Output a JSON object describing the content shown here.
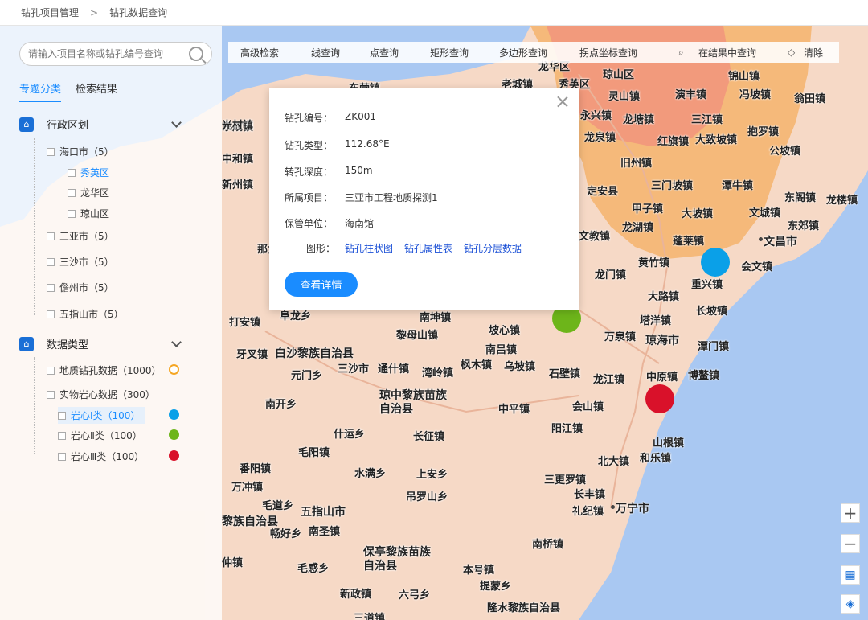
{
  "breadcrumb": [
    "钻孔项目管理",
    "钻孔数据查询"
  ],
  "breadcrumb_sep": ">",
  "search": {
    "placeholder": "请输入项目名称或钻孔编号查询"
  },
  "left_tabs": [
    "专题分类",
    "检索结果"
  ],
  "admin": {
    "title": "行政区划",
    "items": [
      {
        "label": "海口市（5）"
      },
      {
        "label": "秀英区"
      },
      {
        "label": "龙华区"
      },
      {
        "label": "琼山区"
      },
      {
        "label": "三亚市（5）"
      },
      {
        "label": "三沙市（5）"
      },
      {
        "label": "儋州市（5）"
      },
      {
        "label": "五指山市（5）"
      }
    ]
  },
  "datatype": {
    "title": "数据类型",
    "items": [
      {
        "label": "地质钻孔数据（1000）",
        "color": "#f5a623",
        "style": "ring"
      },
      {
        "label": "实物岩心数据（300）"
      },
      {
        "label": "岩心Ⅰ类（100）",
        "color": "#0aa0e8"
      },
      {
        "label": "岩心Ⅱ类（100）",
        "color": "#6db51a"
      },
      {
        "label": "岩心Ⅲ类（100）",
        "color": "#d9112a"
      }
    ]
  },
  "toolbar": [
    "高级检索",
    "线查询",
    "点查询",
    "矩形查询",
    "多边形查询",
    "拐点坐标查询",
    "在结果中查询",
    "清除"
  ],
  "popup": {
    "rows": [
      {
        "k": "钻孔编号：",
        "v": "ZK001"
      },
      {
        "k": "钻孔类型：",
        "v": "112.68°E"
      },
      {
        "k": "转孔深度：",
        "v": "150m"
      },
      {
        "k": "所属项目：",
        "v": "三亚市工程地质探测1"
      },
      {
        "k": "保管单位：",
        "v": "海南馆"
      }
    ],
    "graph_label": "图形：",
    "links": [
      "钻孔柱状图",
      "钻孔属性表",
      "钻孔分层数据"
    ],
    "button": "查看详情"
  },
  "colors": {
    "accent": "#1a8cff",
    "sea": "#a9c8f2",
    "land": "#f6d9c6",
    "zone_orange": "#f5b97a",
    "zone_red": "#f29a7c"
  },
  "map_labels": [
    "龙华区",
    "琼山区",
    "秀英区",
    "东营镇",
    "老城镇",
    "锦山镇",
    "灵山镇",
    "演丰镇",
    "冯坡镇",
    "翁田镇",
    "三江镇",
    "永兴镇",
    "龙塘镇",
    "龙泉镇",
    "红旗镇",
    "大致坡镇",
    "抱罗镇",
    "公坡镇",
    "旧州镇",
    "三门坡镇",
    "潭牛镇",
    "东阁镇",
    "龙楼镇",
    "定安县",
    "甲子镇",
    "大坡镇",
    "文城镇",
    "东郊镇",
    "龙湖镇",
    "文教镇",
    "蓬莱镇",
    "文昌市",
    "黄竹镇",
    "会文镇",
    "龙门镇",
    "重兴镇",
    "大路镇",
    "长坡镇",
    "塔洋镇",
    "万泉镇",
    "琼海市",
    "潭门镇",
    "中原镇",
    "博鳌镇",
    "龙江镇",
    "石壁镇",
    "乌坡镇",
    "枫木镇",
    "南吕镇",
    "坡心镇",
    "黎母山镇",
    "南坤镇",
    "会山镇",
    "中平镇",
    "阳江镇",
    "北大镇",
    "和乐镇",
    "山根镇",
    "三更罗镇",
    "长丰镇",
    "礼纪镇",
    "万宁市",
    "南桥镇",
    "本号镇",
    "提蒙乡",
    "隆水黎族自治县",
    "六弓乡",
    "新政镇",
    "保亭黎族苗族自治县",
    "毛感乡",
    "吊罗山乡",
    "上安乡",
    "水满乡",
    "长征镇",
    "什运乡",
    "毛阳镇",
    "琼中黎族苗族自治县",
    "湾岭镇",
    "通什镇",
    "三沙市",
    "元门乡",
    "南开乡",
    "牙叉镇",
    "白沙黎族自治县",
    "打安镇",
    "阜龙乡",
    "番阳镇",
    "万冲镇",
    "毛道乡",
    "五指山市",
    "畅好乡",
    "南圣镇",
    "黎族自治县",
    "三道镇",
    "仲镇",
    "东成镇",
    "中和镇",
    "那大",
    "新州镇",
    "光村镇"
  ]
}
